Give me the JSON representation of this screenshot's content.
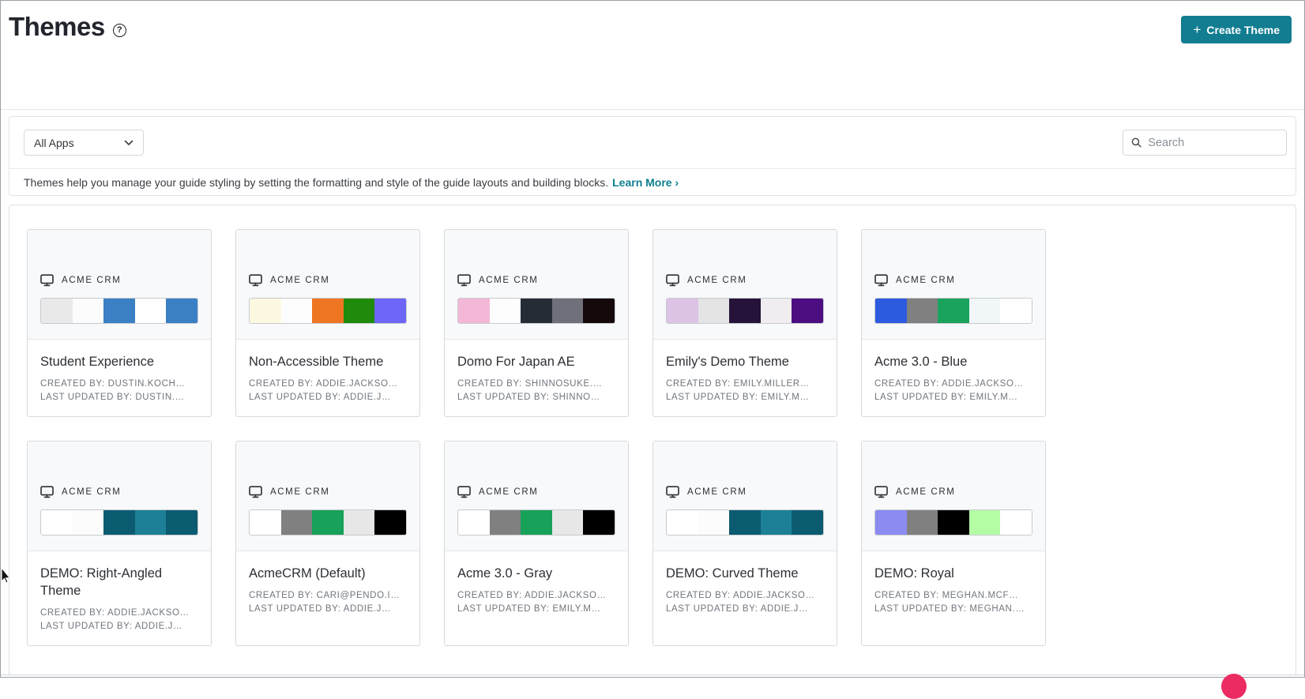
{
  "page": {
    "title": "Themes",
    "create_button": {
      "icon": "+",
      "label": "Create Theme"
    },
    "filters": {
      "app_filter_value": "All Apps",
      "search_placeholder": "Search"
    },
    "description": {
      "text": "Themes help you manage your guide styling by setting the formatting and style of the guide layouts and building blocks.",
      "link": "Learn More ›"
    }
  },
  "colors": {
    "accent_teal": "#127D91",
    "link_teal": "#0C7F91",
    "notification_pink": "#EC2B62"
  },
  "themes": [
    {
      "app": "ACME CRM",
      "name": "Student Experience",
      "created_by": "CREATED BY: DUSTIN.KOCH…",
      "updated_by": "LAST UPDATED BY: DUSTIN.…",
      "palette": [
        "#e9e9ea",
        "#fcfcfc",
        "#3b7fc4",
        "#ffffff",
        "#3b7fc4"
      ]
    },
    {
      "app": "ACME CRM",
      "name": "Non-Accessible Theme",
      "created_by": "CREATED BY: ADDIE.JACKSO…",
      "updated_by": "LAST UPDATED BY: ADDIE.J…",
      "palette": [
        "#fdf8e2",
        "#fdfdfd",
        "#ee7623",
        "#1f8a0c",
        "#6e66f7"
      ]
    },
    {
      "app": "ACME CRM",
      "name": "Domo For Japan AE",
      "created_by": "CREATED BY: SHINNOSUKE.…",
      "updated_by": "LAST UPDATED BY: SHINNO…",
      "palette": [
        "#f3b8d8",
        "#fdfdfd",
        "#262c36",
        "#70707a",
        "#15090c"
      ]
    },
    {
      "app": "ACME CRM",
      "name": "Emily's Demo Theme",
      "created_by": "CREATED BY: EMILY.MILLER…",
      "updated_by": "LAST UPDATED BY: EMILY.M…",
      "palette": [
        "#ddc3e6",
        "#e4e4e5",
        "#251339",
        "#efedf0",
        "#4c0d80"
      ]
    },
    {
      "app": "ACME CRM",
      "name": "Acme 3.0 - Blue",
      "created_by": "CREATED BY: ADDIE.JACKSO…",
      "updated_by": "LAST UPDATED BY: EMILY.M…",
      "palette": [
        "#2c5be0",
        "#808080",
        "#19a35c",
        "#f1f6f9",
        "#ffffff"
      ]
    },
    {
      "app": "ACME CRM",
      "name": "DEMO: Right-Angled Theme",
      "created_by": "CREATED BY: ADDIE.JACKSO…",
      "updated_by": "LAST UPDATED BY: ADDIE.J…",
      "palette": [
        "#ffffff",
        "#fcfcfc",
        "#0b5b71",
        "#1d8096",
        "#0b5b71"
      ]
    },
    {
      "app": "ACME CRM",
      "name": "AcmeCRM (Default)",
      "created_by": "CREATED BY: CARI@PENDO.I…",
      "updated_by": "LAST UPDATED BY: ADDIE.J…",
      "palette": [
        "#ffffff",
        "#808080",
        "#17a159",
        "#e7e7e7",
        "#000000"
      ]
    },
    {
      "app": "ACME CRM",
      "name": "Acme 3.0 - Gray",
      "created_by": "CREATED BY: ADDIE.JACKSO…",
      "updated_by": "LAST UPDATED BY: EMILY.M…",
      "palette": [
        "#ffffff",
        "#808080",
        "#17a159",
        "#e7e7e7",
        "#000000"
      ]
    },
    {
      "app": "ACME CRM",
      "name": "DEMO: Curved Theme",
      "created_by": "CREATED BY: ADDIE.JACKSO…",
      "updated_by": "LAST UPDATED BY: ADDIE.J…",
      "palette": [
        "#ffffff",
        "#fcfcfc",
        "#0b5b71",
        "#1d8096",
        "#0b5b71"
      ]
    },
    {
      "app": "ACME CRM",
      "name": "DEMO: Royal",
      "created_by": "CREATED BY: MEGHAN.MCF…",
      "updated_by": "LAST UPDATED BY: MEGHAN.…",
      "palette": [
        "#8b8bf2",
        "#808080",
        "#000000",
        "#b5fda5",
        "#ffffff"
      ]
    }
  ]
}
